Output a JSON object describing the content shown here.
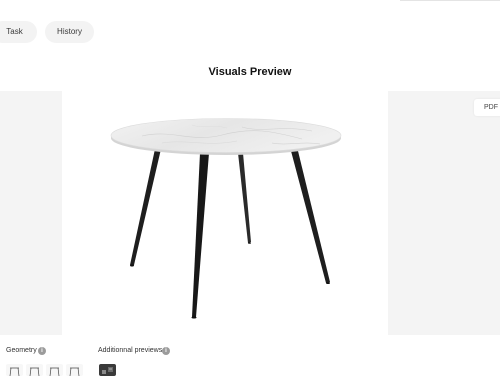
{
  "header": {
    "tabs": [
      {
        "label": "Task"
      },
      {
        "label": "History"
      }
    ]
  },
  "main": {
    "title": "Visuals Preview",
    "pdf_label": "PDF",
    "pdf_arrow": "›"
  },
  "footer": {
    "geometry_label": "Geometry",
    "additional_label": "Additionnal previews",
    "info_glyph": "i"
  },
  "colors": {
    "panel_bg": "#f4f4f4",
    "pill_bg": "#f3f3f3",
    "leg_color": "#1e1e1e",
    "marble": "#eeeeee"
  }
}
